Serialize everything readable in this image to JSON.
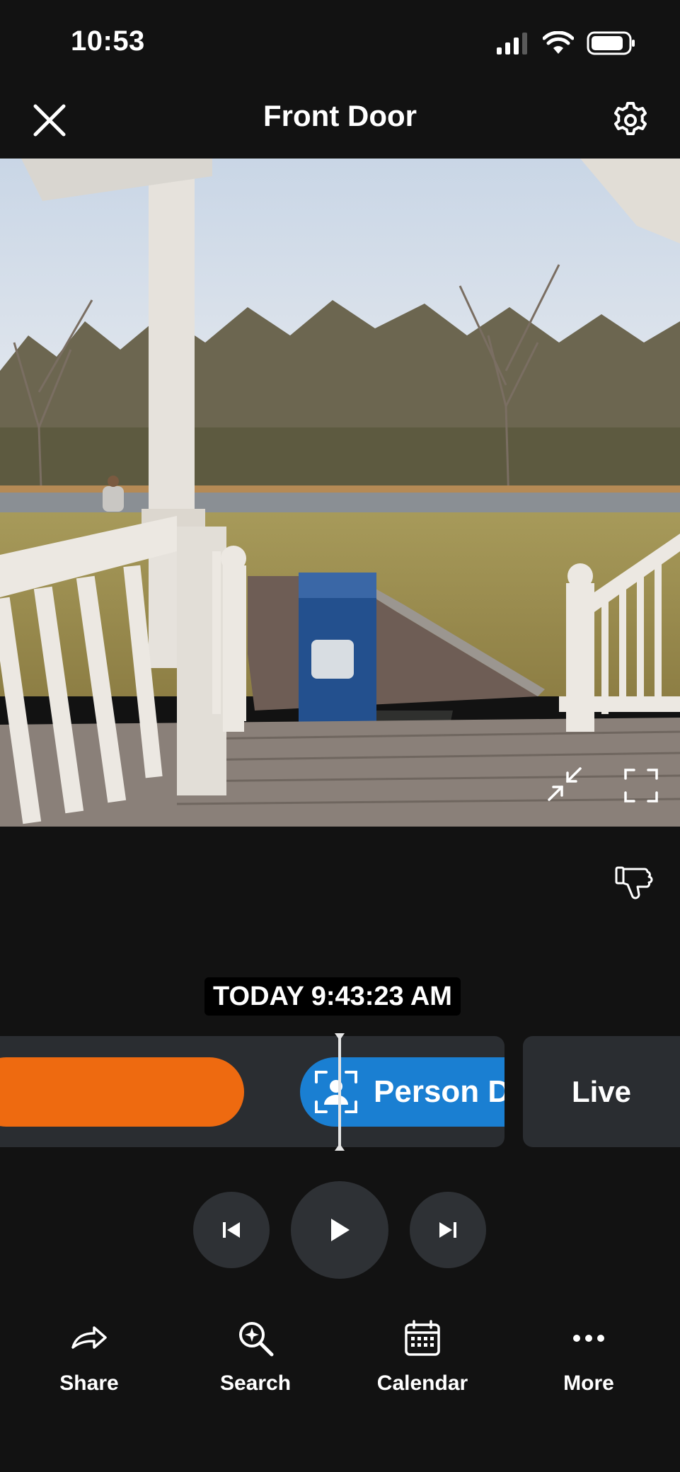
{
  "status_bar": {
    "time": "10:53",
    "icons": [
      "cellular-signal-icon",
      "wifi-icon",
      "battery-icon"
    ]
  },
  "header": {
    "title": "Front Door",
    "left_icon": "close-icon",
    "right_icon": "gear-icon"
  },
  "video": {
    "description_icons": [
      "exit-fullscreen-icon",
      "fullscreen-icon"
    ]
  },
  "feedback_icon": "thumbs-down-icon",
  "timeline": {
    "timestamp": "TODAY 9:43:23 AM",
    "events": [
      {
        "type": "motion",
        "label": "",
        "color": "#ee6a10"
      },
      {
        "type": "person",
        "label": "Person De",
        "color": "#1a7fd2",
        "icon": "person-detected-icon"
      }
    ],
    "live_label": "Live"
  },
  "playback": {
    "prev_icon": "skip-previous-icon",
    "play_icon": "play-icon",
    "next_icon": "skip-next-icon"
  },
  "bottom_bar": {
    "items": [
      {
        "label": "Share",
        "icon": "share-icon"
      },
      {
        "label": "Search",
        "icon": "search-sparkle-icon"
      },
      {
        "label": "Calendar",
        "icon": "calendar-icon"
      },
      {
        "label": "More",
        "icon": "more-icon"
      }
    ]
  },
  "colors": {
    "background": "#121212",
    "panel": "#2a2d31",
    "motion": "#ee6a10",
    "person": "#1a7fd2"
  }
}
